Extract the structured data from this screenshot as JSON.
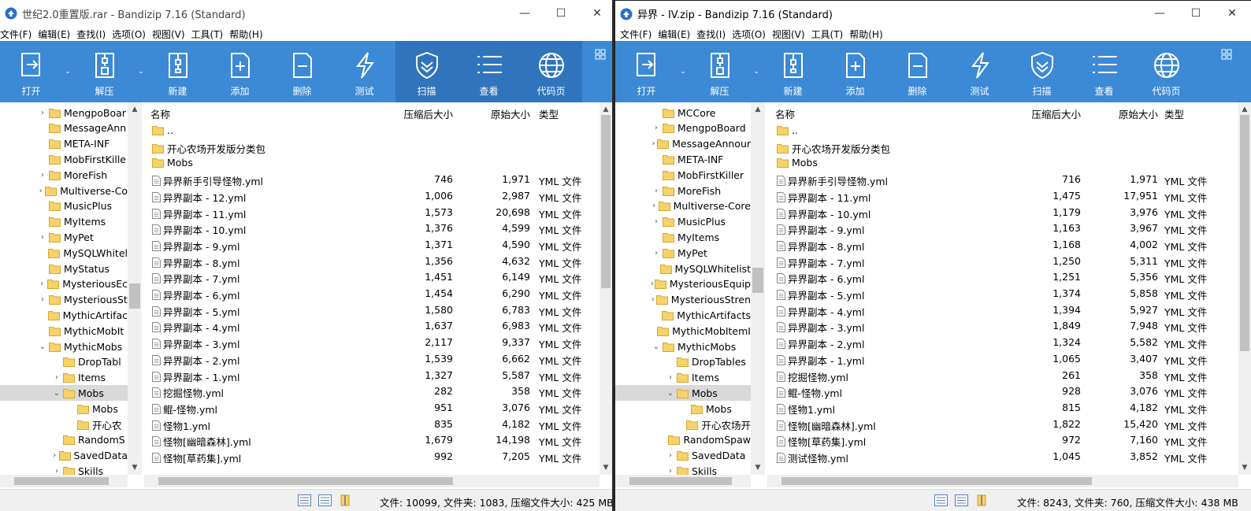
{
  "left_window": {
    "title": "世纪2.0重置版.rar - Bandizip 7.16 (Standard)",
    "menu": [
      "文件(F)",
      "编辑(E)",
      "查找(I)",
      "选项(O)",
      "视图(V)",
      "工具(T)",
      "帮助(H)"
    ],
    "toolbar": [
      {
        "label": "打开",
        "icon": "open-icon"
      },
      {
        "label": "解压",
        "icon": "extract-icon"
      },
      {
        "label": "新建",
        "icon": "new-archive-icon"
      },
      {
        "label": "添加",
        "icon": "add-file-icon"
      },
      {
        "label": "删除",
        "icon": "delete-file-icon"
      },
      {
        "label": "测试",
        "icon": "test-icon"
      },
      {
        "label": "扫描",
        "icon": "scan-shield-icon"
      },
      {
        "label": "查看",
        "icon": "view-list-icon"
      },
      {
        "label": "代码页",
        "icon": "codepage-globe-icon"
      }
    ],
    "tree": [
      {
        "label": "MengpoBoar",
        "expander": "›",
        "level": 0
      },
      {
        "label": "MessageAnn",
        "expander": "",
        "level": 0
      },
      {
        "label": "META-INF",
        "expander": "",
        "level": 0
      },
      {
        "label": "MobFirstKille",
        "expander": "",
        "level": 0
      },
      {
        "label": "MoreFish",
        "expander": "›",
        "level": 0
      },
      {
        "label": "Multiverse-Co",
        "expander": "›",
        "level": 0
      },
      {
        "label": "MusicPlus",
        "expander": "",
        "level": 0
      },
      {
        "label": "MyItems",
        "expander": "",
        "level": 0
      },
      {
        "label": "MyPet",
        "expander": "›",
        "level": 0
      },
      {
        "label": "MySQLWhitel",
        "expander": "",
        "level": 0
      },
      {
        "label": "MyStatus",
        "expander": "",
        "level": 0
      },
      {
        "label": "MysteriousEc",
        "expander": "›",
        "level": 0
      },
      {
        "label": "MysteriousSt",
        "expander": "›",
        "level": 0
      },
      {
        "label": "MythicArtifac",
        "expander": "",
        "level": 0
      },
      {
        "label": "MythicMobIt",
        "expander": "",
        "level": 0
      },
      {
        "label": "MythicMobs",
        "expander": "⌄",
        "level": 0
      },
      {
        "label": "DropTabl",
        "expander": "",
        "level": 1
      },
      {
        "label": "Items",
        "expander": "›",
        "level": 1
      },
      {
        "label": "Mobs",
        "expander": "⌄",
        "level": 1,
        "selected": true
      },
      {
        "label": "Mobs",
        "expander": "",
        "level": 2
      },
      {
        "label": "开心农",
        "expander": "",
        "level": 2
      },
      {
        "label": "RandomS",
        "expander": "",
        "level": 1
      },
      {
        "label": "SavedData",
        "expander": "›",
        "level": 1
      },
      {
        "label": "Skills",
        "expander": "›",
        "level": 1
      }
    ],
    "columns": {
      "name": "名称",
      "packed": "压缩后大小",
      "original": "原始大小",
      "type": "类型"
    },
    "files": [
      {
        "name": "..",
        "packed": "",
        "original": "",
        "type": "",
        "kind": "folder"
      },
      {
        "name": "开心农场开发版分类包",
        "packed": "",
        "original": "",
        "type": "",
        "kind": "folder"
      },
      {
        "name": "Mobs",
        "packed": "",
        "original": "",
        "type": "",
        "kind": "folder"
      },
      {
        "name": "异界新手引导怪物.yml",
        "packed": "746",
        "original": "1,971",
        "type": "YML 文件",
        "kind": "file"
      },
      {
        "name": "异界副本 - 12.yml",
        "packed": "1,006",
        "original": "2,987",
        "type": "YML 文件",
        "kind": "file"
      },
      {
        "name": "异界副本 - 11.yml",
        "packed": "1,573",
        "original": "20,698",
        "type": "YML 文件",
        "kind": "file"
      },
      {
        "name": "异界副本 - 10.yml",
        "packed": "1,376",
        "original": "4,599",
        "type": "YML 文件",
        "kind": "file"
      },
      {
        "name": "异界副本 - 9.yml",
        "packed": "1,371",
        "original": "4,590",
        "type": "YML 文件",
        "kind": "file"
      },
      {
        "name": "异界副本 - 8.yml",
        "packed": "1,356",
        "original": "4,632",
        "type": "YML 文件",
        "kind": "file"
      },
      {
        "name": "异界副本 - 7.yml",
        "packed": "1,451",
        "original": "6,149",
        "type": "YML 文件",
        "kind": "file"
      },
      {
        "name": "异界副本 - 6.yml",
        "packed": "1,454",
        "original": "6,290",
        "type": "YML 文件",
        "kind": "file"
      },
      {
        "name": "异界副本 - 5.yml",
        "packed": "1,580",
        "original": "6,783",
        "type": "YML 文件",
        "kind": "file"
      },
      {
        "name": "异界副本 - 4.yml",
        "packed": "1,637",
        "original": "6,983",
        "type": "YML 文件",
        "kind": "file"
      },
      {
        "name": "异界副本 - 3.yml",
        "packed": "2,117",
        "original": "9,337",
        "type": "YML 文件",
        "kind": "file"
      },
      {
        "name": "异界副本 - 2.yml",
        "packed": "1,539",
        "original": "6,662",
        "type": "YML 文件",
        "kind": "file"
      },
      {
        "name": "异界副本 - 1.yml",
        "packed": "1,327",
        "original": "5,587",
        "type": "YML 文件",
        "kind": "file"
      },
      {
        "name": "挖掘怪物.yml",
        "packed": "282",
        "original": "358",
        "type": "YML 文件",
        "kind": "file"
      },
      {
        "name": "鲲-怪物.yml",
        "packed": "951",
        "original": "3,076",
        "type": "YML 文件",
        "kind": "file"
      },
      {
        "name": "怪物1.yml",
        "packed": "835",
        "original": "4,182",
        "type": "YML 文件",
        "kind": "file"
      },
      {
        "name": "怪物[幽暗森林].yml",
        "packed": "1,679",
        "original": "14,198",
        "type": "YML 文件",
        "kind": "file"
      },
      {
        "name": "怪物[草药集].yml",
        "packed": "992",
        "original": "7,205",
        "type": "YML 文件",
        "kind": "file"
      }
    ],
    "status": "文件: 10099, 文件夹: 1083, 压缩文件大小: 425 MB"
  },
  "right_window": {
    "title": "异界 - IV.zip - Bandizip 7.16 (Standard)",
    "menu": [
      "文件(F)",
      "编辑(E)",
      "查找(I)",
      "选项(O)",
      "视图(V)",
      "工具(T)",
      "帮助(H)"
    ],
    "toolbar": [
      {
        "label": "打开",
        "icon": "open-icon"
      },
      {
        "label": "解压",
        "icon": "extract-icon"
      },
      {
        "label": "新建",
        "icon": "new-archive-icon"
      },
      {
        "label": "添加",
        "icon": "add-file-icon"
      },
      {
        "label": "删除",
        "icon": "delete-file-icon"
      },
      {
        "label": "测试",
        "icon": "test-icon"
      },
      {
        "label": "扫描",
        "icon": "scan-shield-icon"
      },
      {
        "label": "查看",
        "icon": "view-list-icon"
      },
      {
        "label": "代码页",
        "icon": "codepage-globe-icon"
      }
    ],
    "tree": [
      {
        "label": "MCCore",
        "expander": "",
        "level": 0
      },
      {
        "label": "MengpoBoard",
        "expander": "›",
        "level": 0
      },
      {
        "label": "MessageAnnour",
        "expander": "›",
        "level": 0
      },
      {
        "label": "META-INF",
        "expander": "",
        "level": 0
      },
      {
        "label": "MobFirstKiller",
        "expander": "",
        "level": 0
      },
      {
        "label": "MoreFish",
        "expander": "›",
        "level": 0
      },
      {
        "label": "Multiverse-Core",
        "expander": "›",
        "level": 0
      },
      {
        "label": "MusicPlus",
        "expander": "›",
        "level": 0
      },
      {
        "label": "MyItems",
        "expander": "",
        "level": 0
      },
      {
        "label": "MyPet",
        "expander": "›",
        "level": 0
      },
      {
        "label": "MySQLWhitelist",
        "expander": "",
        "level": 0
      },
      {
        "label": "MysteriousEquip",
        "expander": "›",
        "level": 0
      },
      {
        "label": "MysteriousStren",
        "expander": "›",
        "level": 0
      },
      {
        "label": "MythicArtifacts",
        "expander": "",
        "level": 0
      },
      {
        "label": "MythicMobItemI",
        "expander": "",
        "level": 0
      },
      {
        "label": "MythicMobs",
        "expander": "⌄",
        "level": 0
      },
      {
        "label": "DropTables",
        "expander": "",
        "level": 1
      },
      {
        "label": "Items",
        "expander": "›",
        "level": 1
      },
      {
        "label": "Mobs",
        "expander": "⌄",
        "level": 1,
        "selected": true
      },
      {
        "label": "Mobs",
        "expander": "",
        "level": 2
      },
      {
        "label": "开心农场开",
        "expander": "",
        "level": 2
      },
      {
        "label": "RandomSpaw",
        "expander": "",
        "level": 1
      },
      {
        "label": "SavedData",
        "expander": "›",
        "level": 1
      },
      {
        "label": "Skills",
        "expander": "›",
        "level": 1
      }
    ],
    "columns": {
      "name": "名称",
      "packed": "压缩后大小",
      "original": "原始大小",
      "type": "类型"
    },
    "files": [
      {
        "name": "..",
        "packed": "",
        "original": "",
        "type": "",
        "kind": "folder"
      },
      {
        "name": "开心农场开发版分类包",
        "packed": "",
        "original": "",
        "type": "",
        "kind": "folder"
      },
      {
        "name": "Mobs",
        "packed": "",
        "original": "",
        "type": "",
        "kind": "folder"
      },
      {
        "name": "异界新手引导怪物.yml",
        "packed": "716",
        "original": "1,971",
        "type": "YML 文件",
        "kind": "file"
      },
      {
        "name": "异界副本 - 11.yml",
        "packed": "1,475",
        "original": "17,951",
        "type": "YML 文件",
        "kind": "file"
      },
      {
        "name": "异界副本 - 10.yml",
        "packed": "1,179",
        "original": "3,976",
        "type": "YML 文件",
        "kind": "file"
      },
      {
        "name": "异界副本 - 9.yml",
        "packed": "1,163",
        "original": "3,967",
        "type": "YML 文件",
        "kind": "file"
      },
      {
        "name": "异界副本 - 8.yml",
        "packed": "1,168",
        "original": "4,002",
        "type": "YML 文件",
        "kind": "file"
      },
      {
        "name": "异界副本 - 7.yml",
        "packed": "1,250",
        "original": "5,311",
        "type": "YML 文件",
        "kind": "file"
      },
      {
        "name": "异界副本 - 6.yml",
        "packed": "1,251",
        "original": "5,356",
        "type": "YML 文件",
        "kind": "file"
      },
      {
        "name": "异界副本 - 5.yml",
        "packed": "1,374",
        "original": "5,858",
        "type": "YML 文件",
        "kind": "file"
      },
      {
        "name": "异界副本 - 4.yml",
        "packed": "1,394",
        "original": "5,927",
        "type": "YML 文件",
        "kind": "file"
      },
      {
        "name": "异界副本 - 3.yml",
        "packed": "1,849",
        "original": "7,948",
        "type": "YML 文件",
        "kind": "file"
      },
      {
        "name": "异界副本 - 2.yml",
        "packed": "1,324",
        "original": "5,582",
        "type": "YML 文件",
        "kind": "file"
      },
      {
        "name": "异界副本 - 1.yml",
        "packed": "1,065",
        "original": "3,407",
        "type": "YML 文件",
        "kind": "file"
      },
      {
        "name": "挖掘怪物.yml",
        "packed": "261",
        "original": "358",
        "type": "YML 文件",
        "kind": "file"
      },
      {
        "name": "鲲-怪物.yml",
        "packed": "928",
        "original": "3,076",
        "type": "YML 文件",
        "kind": "file"
      },
      {
        "name": "怪物1.yml",
        "packed": "815",
        "original": "4,182",
        "type": "YML 文件",
        "kind": "file"
      },
      {
        "name": "怪物[幽暗森林].yml",
        "packed": "1,822",
        "original": "15,420",
        "type": "YML 文件",
        "kind": "file"
      },
      {
        "name": "怪物[草药集].yml",
        "packed": "972",
        "original": "7,160",
        "type": "YML 文件",
        "kind": "file"
      },
      {
        "name": "测试怪物.yml",
        "packed": "1,045",
        "original": "3,852",
        "type": "YML 文件",
        "kind": "file"
      }
    ],
    "status": "文件: 8243, 文件夹: 760, 压缩文件大小: 438 MB"
  },
  "colors": {
    "toolbar_bg": "#3c89d6",
    "toolbar_active": "#2f74bd",
    "folder": "#f6d26b",
    "selected_row": "#d9d9d9"
  }
}
